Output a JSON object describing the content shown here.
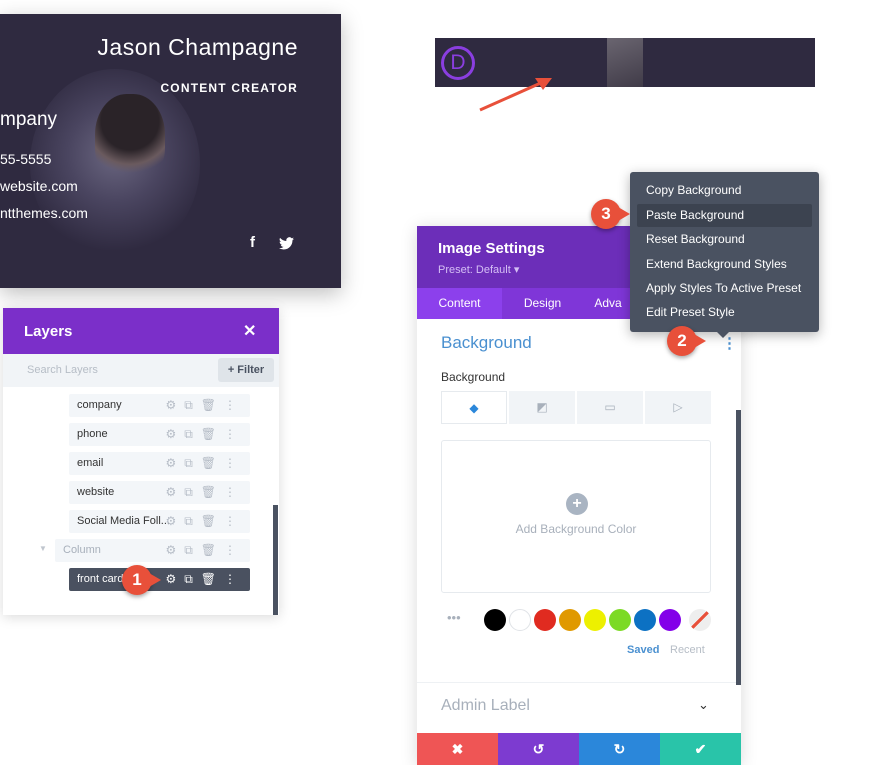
{
  "card": {
    "name": "Jason Champagne",
    "role": "CONTENT CREATOR",
    "company": "mpany",
    "phone": "55-5555",
    "website": "website.com",
    "email": "ntthemes.com",
    "social": [
      "facebook-icon",
      "twitter-icon"
    ]
  },
  "topbar": {
    "logo": "D"
  },
  "layers": {
    "title": "Layers",
    "close": "✕",
    "search_placeholder": "Search Layers",
    "filter": "+ Filter",
    "items": [
      {
        "label": "company"
      },
      {
        "label": "phone"
      },
      {
        "label": "email"
      },
      {
        "label": "website"
      },
      {
        "label": "Social Media Foll..."
      },
      {
        "label": "Column"
      },
      {
        "label": "front card"
      }
    ]
  },
  "settings": {
    "title": "Image Settings",
    "preset": "Preset: Default ▾",
    "tabs": [
      "Content",
      "Design",
      "Adva"
    ],
    "active_tab": "Content",
    "section": "Background",
    "field_label": "Background",
    "add_color": "Add Background Color",
    "saved": "Saved",
    "recent": "Recent",
    "admin_label": "Admin Label",
    "swatches": [
      "#000000",
      "#ffffff",
      "#e02b20",
      "#e09900",
      "#edf000",
      "#7cda24",
      "#0c71c3",
      "#8300e9"
    ]
  },
  "menu": {
    "items": [
      "Copy Background",
      "Paste Background",
      "Reset Background",
      "Extend Background Styles",
      "Apply Styles To Active Preset",
      "Edit Preset Style"
    ],
    "highlighted": "Paste Background"
  },
  "badges": [
    "1",
    "2",
    "3"
  ],
  "colors": {
    "purple": "#7b2fc9",
    "card_bg": "#2f2a40",
    "menu_bg": "#4a5261",
    "link_blue": "#4a90d0",
    "cancel": "#ef5555",
    "undo": "#7d3bd0",
    "redo": "#2b87da",
    "save": "#29c4a9"
  }
}
